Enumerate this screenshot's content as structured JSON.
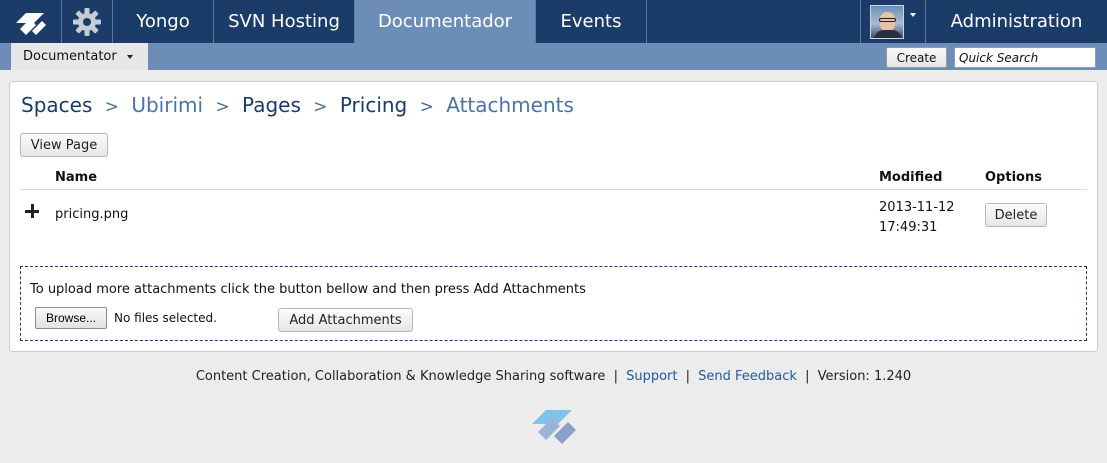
{
  "topnav": {
    "items": [
      {
        "label": "Yongo"
      },
      {
        "label": "SVN Hosting"
      },
      {
        "label": "Documentador",
        "active": true
      },
      {
        "label": "Events"
      }
    ],
    "admin_label": "Administration"
  },
  "subnav": {
    "product_menu_label": "Documentator",
    "create_label": "Create",
    "quick_search_placeholder": "Quick Search"
  },
  "breadcrumb": {
    "items": [
      "Spaces",
      "Ubirimi",
      "Pages",
      "Pricing",
      "Attachments"
    ],
    "separator": ">"
  },
  "view_page_label": "View Page",
  "table": {
    "headers": {
      "name": "Name",
      "modified": "Modified",
      "options": "Options"
    },
    "rows": [
      {
        "name": "pricing.png",
        "modified_date": "2013-11-12",
        "modified_time": "17:49:31",
        "action": "Delete"
      }
    ]
  },
  "upload": {
    "instructions": "To upload more attachments click the button bellow and then press Add Attachments",
    "browse_label": "Browse...",
    "no_files_text": "No files selected.",
    "add_label": "Add Attachments"
  },
  "footer": {
    "text": "Content Creation, Collaboration & Knowledge Sharing software",
    "support_label": "Support",
    "feedback_label": "Send Feedback",
    "version_text": "Version: 1.240",
    "divider": "|"
  },
  "colors": {
    "nav_bg": "#1b3b69",
    "nav_active": "#6b8db8",
    "link": "#1f5a9e"
  }
}
